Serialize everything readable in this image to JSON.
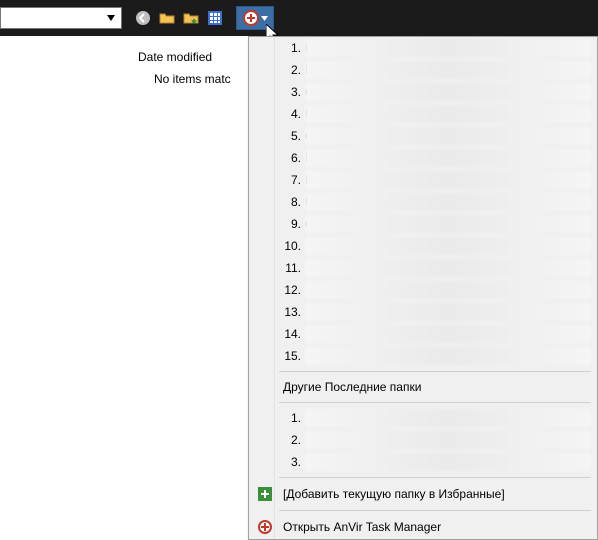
{
  "toolbar": {
    "address_value": "",
    "icons": [
      "back-arrow",
      "folder-open",
      "folder-star",
      "grid-view"
    ],
    "active_button_icon": "plus-circle"
  },
  "content": {
    "column_header": "Date modified",
    "empty_message": "No items matc"
  },
  "dropdown": {
    "recent_prefix_letters": [
      "D",
      "D",
      "C",
      "D",
      "C",
      "D",
      "D",
      "D",
      "C",
      "",
      "",
      "",
      "",
      "",
      ""
    ],
    "recent_count": 15,
    "section_label": "Другие Последние папки",
    "secondary_count": 3,
    "add_favorite": "[Добавить текущую папку в Избранные]",
    "open_anvir": "Открыть AnVir Task Manager"
  }
}
